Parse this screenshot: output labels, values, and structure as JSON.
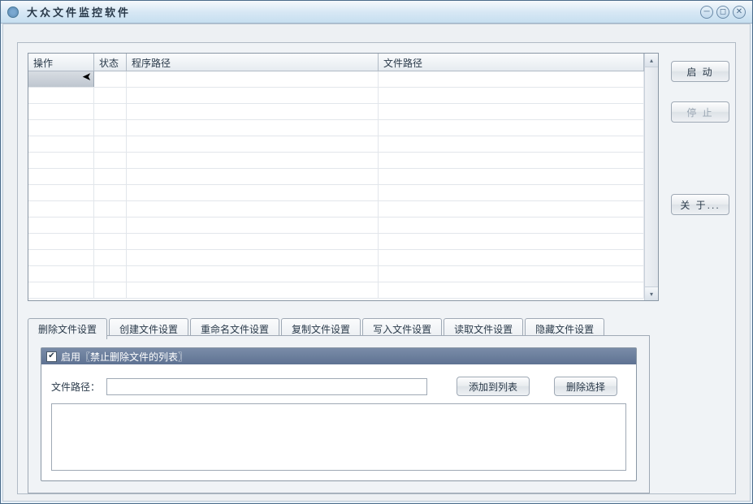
{
  "window": {
    "title": "大众文件监控软件"
  },
  "grid": {
    "headers": {
      "operation": "操作",
      "status": "状态",
      "program_path": "程序路径",
      "file_path": "文件路径"
    }
  },
  "side": {
    "start": "启 动",
    "stop": "停 止",
    "about": "关 于..."
  },
  "tabs": {
    "delete": "删除文件设置",
    "create": "创建文件设置",
    "rename": "重命名文件设置",
    "copy": "复制文件设置",
    "write": "写入文件设置",
    "read": "读取文件设置",
    "hide": "隐藏文件设置"
  },
  "settings_panel": {
    "enable_label": "启用〖禁止删除文件的列表〗",
    "path_label": "文件路径：",
    "path_value": "",
    "add_btn": "添加到列表",
    "remove_btn": "删除选择"
  }
}
